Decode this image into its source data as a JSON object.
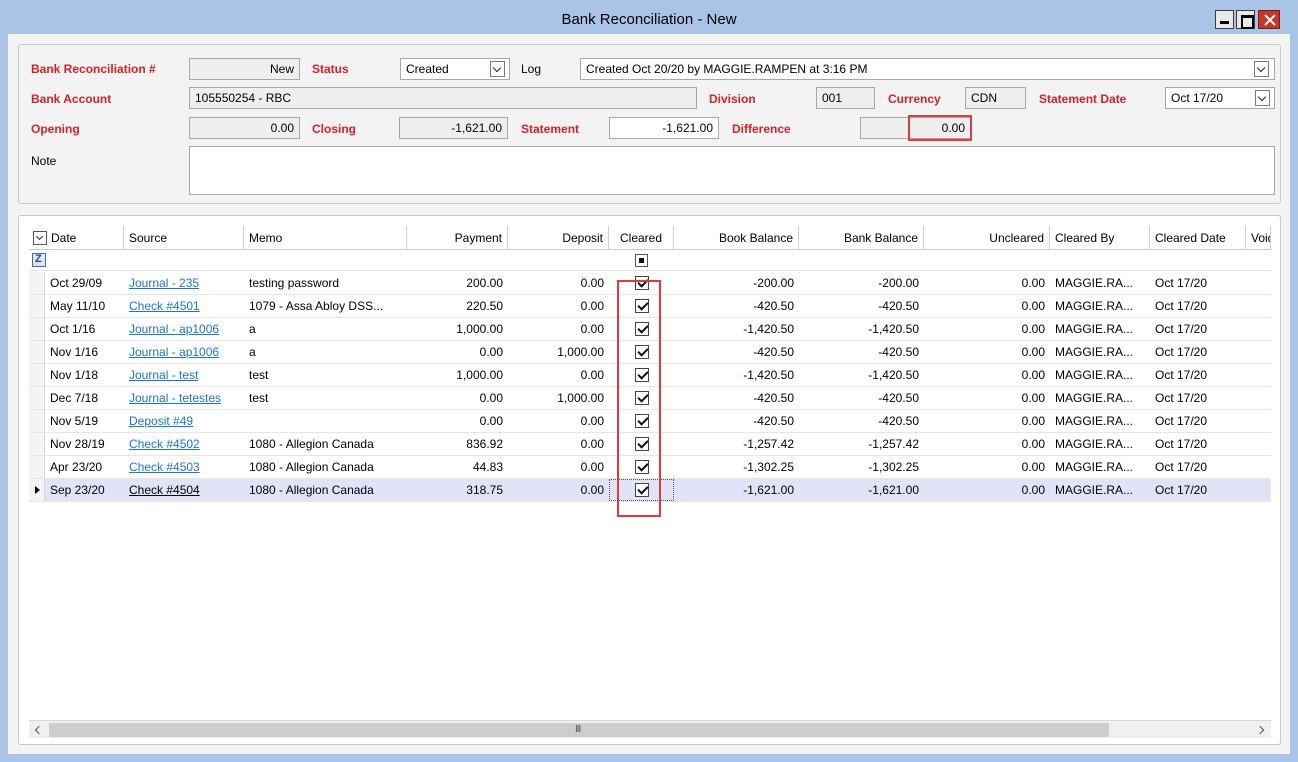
{
  "window": {
    "title": "Bank Reconciliation - New"
  },
  "form": {
    "recon_label": "Bank Reconciliation #",
    "recon_value": "New",
    "status_label": "Status",
    "status_value": "Created",
    "log_label": "Log",
    "log_value": "Created Oct 20/20 by MAGGIE.RAMPEN at 3:16 PM",
    "bank_account_label": "Bank Account",
    "bank_account_value": "105550254 - RBC",
    "division_label": "Division",
    "division_value": "001",
    "currency_label": "Currency",
    "currency_value": "CDN",
    "statement_date_label": "Statement Date",
    "statement_date_value": "Oct 17/20",
    "opening_label": "Opening",
    "opening_value": "0.00",
    "closing_label": "Closing",
    "closing_value": "-1,621.00",
    "statement_label": "Statement",
    "statement_value": "-1,621.00",
    "difference_label": "Difference",
    "difference_value": "0.00",
    "note_label": "Note",
    "note_value": ""
  },
  "grid": {
    "columns": [
      "Date",
      "Source",
      "Memo",
      "Payment",
      "Deposit",
      "Cleared",
      "Book Balance",
      "Bank Balance",
      "Uncleared",
      "Cleared By",
      "Cleared Date",
      "Void"
    ],
    "rows": [
      {
        "date": "Oct 29/09",
        "source": "Journal - 235",
        "memo": "testing password",
        "payment": "200.00",
        "deposit": "0.00",
        "book": "-200.00",
        "bank": "-200.00",
        "uncleared": "0.00",
        "by": "MAGGIE.RA...",
        "cdate": "Oct 17/20"
      },
      {
        "date": "May 11/10",
        "source": "Check #4501",
        "memo": "1079 - Assa Abloy DSS...",
        "payment": "220.50",
        "deposit": "0.00",
        "book": "-420.50",
        "bank": "-420.50",
        "uncleared": "0.00",
        "by": "MAGGIE.RA...",
        "cdate": "Oct 17/20"
      },
      {
        "date": "Oct 1/16",
        "source": "Journal - ap1006",
        "memo": "a",
        "payment": "1,000.00",
        "deposit": "0.00",
        "book": "-1,420.50",
        "bank": "-1,420.50",
        "uncleared": "0.00",
        "by": "MAGGIE.RA...",
        "cdate": "Oct 17/20"
      },
      {
        "date": "Nov 1/16",
        "source": "Journal - ap1006",
        "memo": "a",
        "payment": "0.00",
        "deposit": "1,000.00",
        "book": "-420.50",
        "bank": "-420.50",
        "uncleared": "0.00",
        "by": "MAGGIE.RA...",
        "cdate": "Oct 17/20"
      },
      {
        "date": "Nov 1/18",
        "source": "Journal - test",
        "memo": "test",
        "payment": "1,000.00",
        "deposit": "0.00",
        "book": "-1,420.50",
        "bank": "-1,420.50",
        "uncleared": "0.00",
        "by": "MAGGIE.RA...",
        "cdate": "Oct 17/20"
      },
      {
        "date": "Dec 7/18",
        "source": "Journal - tetestes",
        "memo": "test",
        "payment": "0.00",
        "deposit": "1,000.00",
        "book": "-420.50",
        "bank": "-420.50",
        "uncleared": "0.00",
        "by": "MAGGIE.RA...",
        "cdate": "Oct 17/20"
      },
      {
        "date": "Nov 5/19",
        "source": "Deposit #49",
        "memo": "",
        "payment": "0.00",
        "deposit": "0.00",
        "book": "-420.50",
        "bank": "-420.50",
        "uncleared": "0.00",
        "by": "MAGGIE.RA...",
        "cdate": "Oct 17/20"
      },
      {
        "date": "Nov 28/19",
        "source": "Check #4502",
        "memo": "1080 - Allegion Canada",
        "payment": "836.92",
        "deposit": "0.00",
        "book": "-1,257.42",
        "bank": "-1,257.42",
        "uncleared": "0.00",
        "by": "MAGGIE.RA...",
        "cdate": "Oct 17/20"
      },
      {
        "date": "Apr 23/20",
        "source": "Check #4503",
        "memo": "1080 - Allegion Canada",
        "payment": "44.83",
        "deposit": "0.00",
        "book": "-1,302.25",
        "bank": "-1,302.25",
        "uncleared": "0.00",
        "by": "MAGGIE.RA...",
        "cdate": "Oct 17/20"
      },
      {
        "date": "Sep 23/20",
        "source": "Check #4504",
        "memo": "1080 - Allegion Canada",
        "payment": "318.75",
        "deposit": "0.00",
        "book": "-1,621.00",
        "bank": "-1,621.00",
        "uncleared": "0.00",
        "by": "MAGGIE.RA...",
        "cdate": "Oct 17/20"
      }
    ]
  },
  "icons": {
    "minimize": "minimize-icon",
    "maximize": "maximize-icon",
    "close": "close-icon",
    "filter": "filter-icon",
    "dropdown": "chevron-down-icon"
  }
}
